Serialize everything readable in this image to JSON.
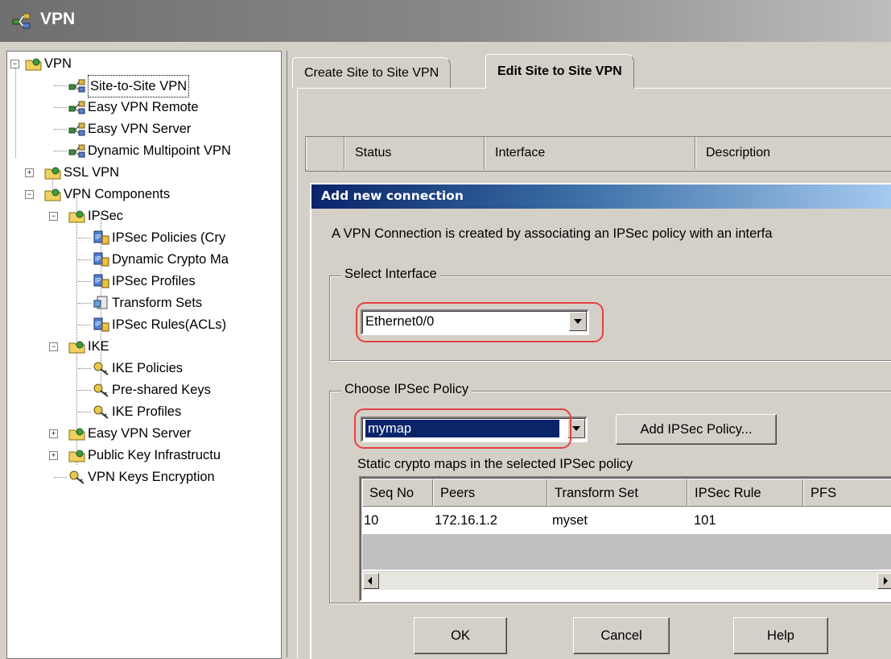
{
  "window": {
    "title": "VPN",
    "icon": "vpn-network-icon"
  },
  "tree": {
    "root": {
      "label": "VPN",
      "icon": "folder-lock-icon",
      "expander": "⊟"
    },
    "items": [
      {
        "label": "Site-to-Site VPN",
        "icon": "vpn-nodes-icon",
        "selected": true
      },
      {
        "label": "Easy VPN Remote",
        "icon": "vpn-nodes-icon"
      },
      {
        "label": "Easy VPN Server",
        "icon": "vpn-nodes-icon"
      },
      {
        "label": "Dynamic Multipoint VPN",
        "icon": "vpn-nodes-icon"
      },
      {
        "label": "SSL VPN",
        "icon": "folder-lock-icon",
        "expander": "⊞"
      },
      {
        "label": "VPN Components",
        "icon": "folder-lock-icon",
        "expander": "⊟"
      },
      {
        "label": "IPSec",
        "icon": "folder-lock-icon",
        "expander": "⊟"
      },
      {
        "label": "IPSec Policies (Cry",
        "icon": "ip-doc-icon"
      },
      {
        "label": "Dynamic Crypto Ma",
        "icon": "ip-doc-icon"
      },
      {
        "label": "IPSec Profiles",
        "icon": "ip-doc-icon"
      },
      {
        "label": "Transform Sets",
        "icon": "transform-icon"
      },
      {
        "label": "IPSec Rules(ACLs)",
        "icon": "ip-doc-icon"
      },
      {
        "label": "IKE",
        "icon": "folder-lock-icon",
        "expander": "⊟"
      },
      {
        "label": "IKE Policies",
        "icon": "key-icon"
      },
      {
        "label": "Pre-shared Keys",
        "icon": "key-icon"
      },
      {
        "label": "IKE Profiles",
        "icon": "key-icon"
      },
      {
        "label": "Easy VPN Server",
        "icon": "folder-lock-icon",
        "expander": "⊞"
      },
      {
        "label": "Public Key Infrastructu",
        "icon": "folder-lock-icon",
        "expander": "⊞"
      },
      {
        "label": "VPN Keys Encryption",
        "icon": "key-icon"
      }
    ]
  },
  "tabs": [
    {
      "label": "Create Site to Site VPN",
      "active": false
    },
    {
      "label": "Edit Site to Site VPN",
      "active": true
    }
  ],
  "connections_grid": {
    "columns": [
      "",
      "Status",
      "Interface",
      "Description"
    ]
  },
  "dialog": {
    "title": "Add new connection",
    "description": "A VPN Connection is created by associating an IPSec policy with an interfa",
    "select_interface": {
      "legend": "Select Interface",
      "value": "Ethernet0/0"
    },
    "ipsec_policy": {
      "legend": "Choose IPSec Policy",
      "value": "mymap",
      "add_button": "Add IPSec Policy..."
    },
    "crypto_maps_label": "Static crypto maps in the selected IPSec policy",
    "crypto_maps_table": {
      "columns": [
        "Seq No",
        "Peers",
        "Transform Set",
        "IPSec Rule",
        "PFS"
      ],
      "rows": [
        [
          "10",
          "172.16.1.2",
          "myset",
          "101",
          ""
        ]
      ]
    },
    "buttons": {
      "ok": "OK",
      "cancel": "Cancel",
      "help": "Help"
    }
  },
  "colors": {
    "dialog_title_gradient_start": "#0a246a",
    "highlight_ring": "#e34242",
    "window_face": "#d4d0c8"
  }
}
